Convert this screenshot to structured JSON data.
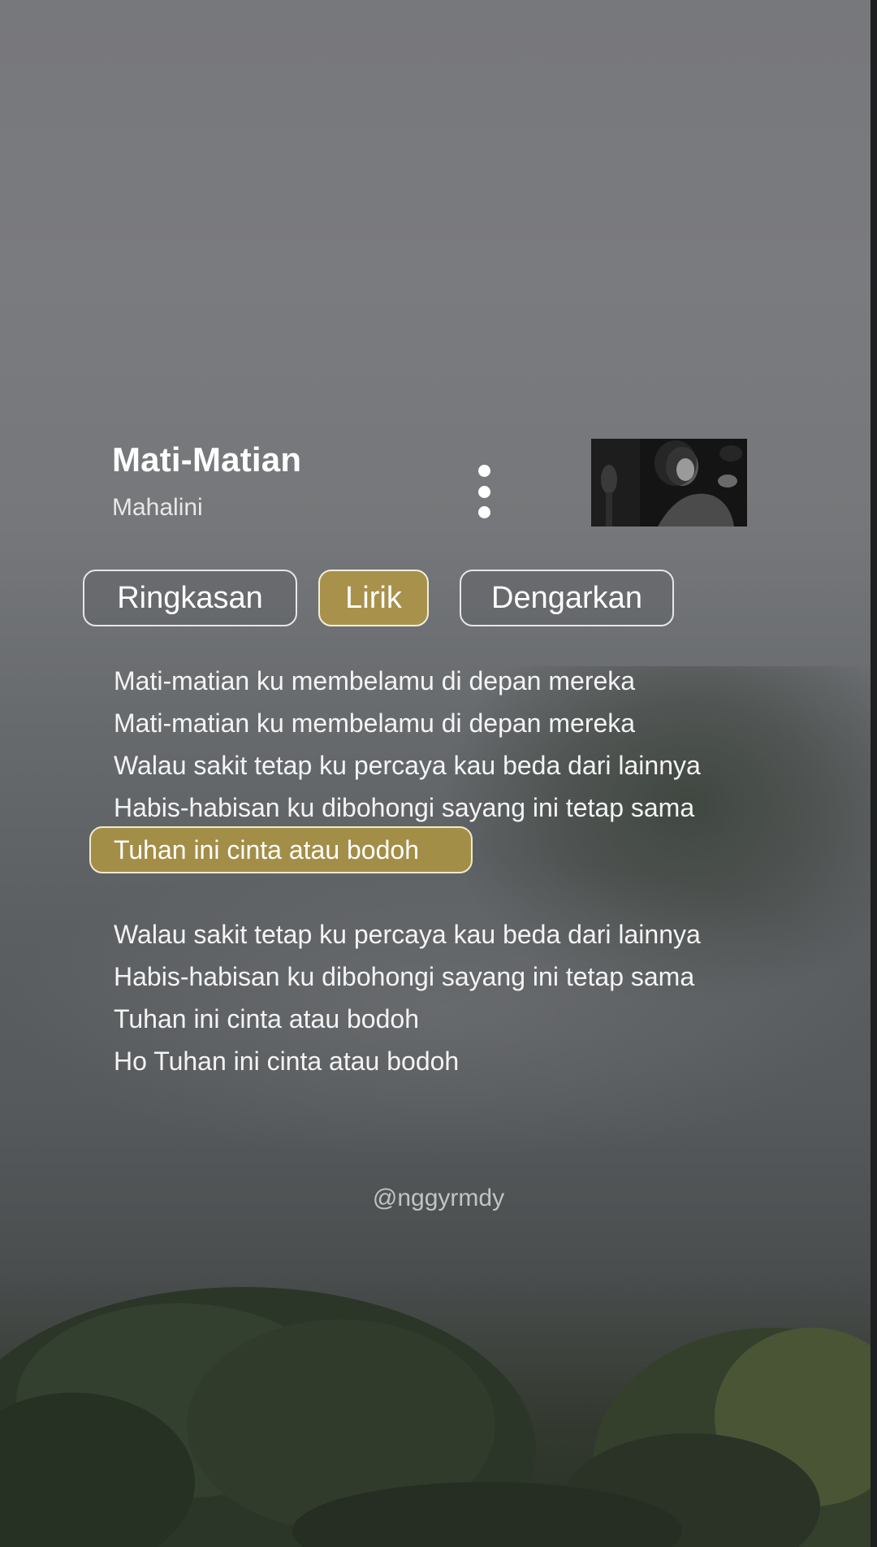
{
  "song": {
    "title": "Mati-Matian",
    "artist": "Mahalini"
  },
  "tabs": [
    {
      "label": "Ringkasan",
      "selected": false
    },
    {
      "label": "Lirik",
      "selected": true
    },
    {
      "label": "Dengarkan",
      "selected": false
    }
  ],
  "lyrics": {
    "lines": [
      "Mati-matian ku membelamu di depan mereka",
      "Mati-matian ku membelamu di depan mereka",
      "Walau sakit tetap ku percaya kau beda dari lainnya",
      "Habis-habisan ku dibohongi sayang ini tetap sama",
      "Tuhan ini cinta atau bodoh",
      "",
      "Walau sakit tetap ku percaya kau beda dari lainnya",
      "Habis-habisan ku dibohongi sayang ini tetap sama",
      "Tuhan ini cinta atau bodoh",
      "Ho Tuhan ini cinta atau bodoh"
    ],
    "active_line_index": 4
  },
  "watermark": "@nggyrmdy",
  "icons": {
    "more": "more-vertical-icon"
  },
  "colors": {
    "accent": "#a8924b",
    "accent_border": "#f2eed9"
  }
}
